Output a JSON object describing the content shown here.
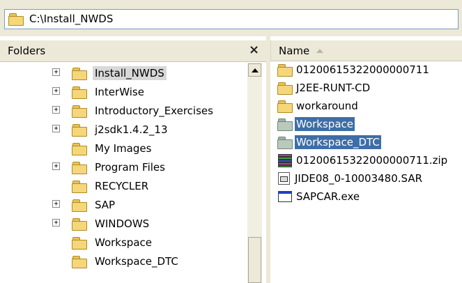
{
  "address_bar": {
    "path": "C:\\Install_NWDS"
  },
  "folders_pane": {
    "title": "Folders",
    "close_glyph": "×",
    "items": [
      {
        "label": "Install_NWDS",
        "expander": "+",
        "current": true
      },
      {
        "label": "InterWise",
        "expander": "+"
      },
      {
        "label": "Introductory_Exercises",
        "expander": "+"
      },
      {
        "label": "j2sdk1.4.2_13",
        "expander": "+"
      },
      {
        "label": "My Images",
        "expander": ""
      },
      {
        "label": "Program Files",
        "expander": "+"
      },
      {
        "label": "RECYCLER",
        "expander": ""
      },
      {
        "label": "SAP",
        "expander": "+"
      },
      {
        "label": "WINDOWS",
        "expander": "+"
      },
      {
        "label": "Workspace",
        "expander": ""
      },
      {
        "label": "Workspace_DTC",
        "expander": ""
      }
    ]
  },
  "files_pane": {
    "column_header": "Name",
    "items": [
      {
        "label": "01200615322000000711",
        "icon": "folder-icon"
      },
      {
        "label": "J2EE-RUNT-CD",
        "icon": "folder-icon"
      },
      {
        "label": "workaround",
        "icon": "folder-icon"
      },
      {
        "label": "Workspace",
        "icon": "folder-gray-icon",
        "selected": true
      },
      {
        "label": "Workspace_DTC",
        "icon": "folder-gray-icon",
        "selected": true
      },
      {
        "label": "01200615322000000711.zip",
        "icon": "zip-archive-icon"
      },
      {
        "label": "JIDE08_0-10003480.SAR",
        "icon": "sar-file-icon"
      },
      {
        "label": "SAPCAR.exe",
        "icon": "exe-application-icon"
      }
    ]
  },
  "colors": {
    "selection": "#3e6ea7",
    "chrome": "#ece9d8",
    "folder": "#f5d77a"
  }
}
